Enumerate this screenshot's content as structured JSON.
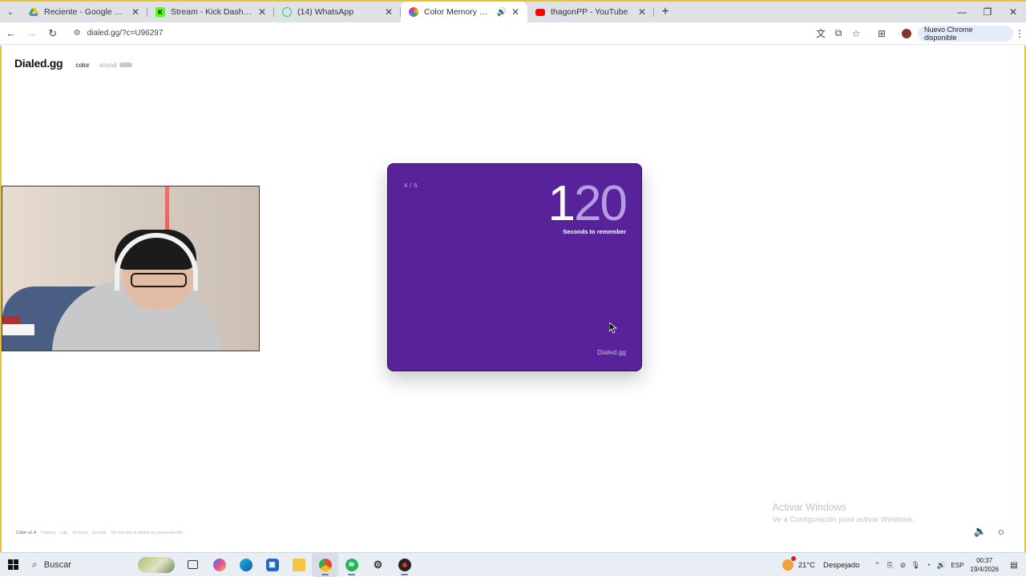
{
  "browser": {
    "tabs": [
      {
        "title": "Reciente - Google Drive",
        "icon": "google-drive-icon",
        "color": "#1a73e8"
      },
      {
        "title": "Stream - Kick Dashboard",
        "icon": "kick-icon",
        "color": "#53fc18"
      },
      {
        "title": "(14) WhatsApp",
        "icon": "whatsapp-icon",
        "color": "#25d366"
      },
      {
        "title": "Color Memory Game — Hu",
        "icon": "color-wheel-icon",
        "color": "#e94d8b"
      },
      {
        "title": "thagonPP - YouTube",
        "icon": "youtube-icon",
        "color": "#ff0000"
      }
    ],
    "url": "dialed.gg/?c=U96297",
    "update_label": "Nuevo Chrome disponible"
  },
  "site": {
    "logo": "Dialed.gg",
    "mode_color": "color",
    "mode_sound": "sound"
  },
  "game": {
    "round": "4 / 5",
    "timer_lead": "1",
    "timer_rest": "20",
    "timer_label": "Seconds to remember",
    "brand": "Dialed.gg",
    "card_color": "#58239a"
  },
  "footer": {
    "links": [
      "Color v1.4",
      "Privacy",
      "Lab",
      "Scoring",
      "Socials",
      "Do not sell or share my personal info"
    ]
  },
  "watermark": {
    "title": "Activar Windows",
    "subtitle": "Ve a Configuración para activar Windows."
  },
  "taskbar": {
    "search_label": "Buscar",
    "weather_temp": "21°C",
    "weather_text": "Despejado",
    "lang": "ESP",
    "time": "00:37",
    "date": "19/4/2026"
  }
}
